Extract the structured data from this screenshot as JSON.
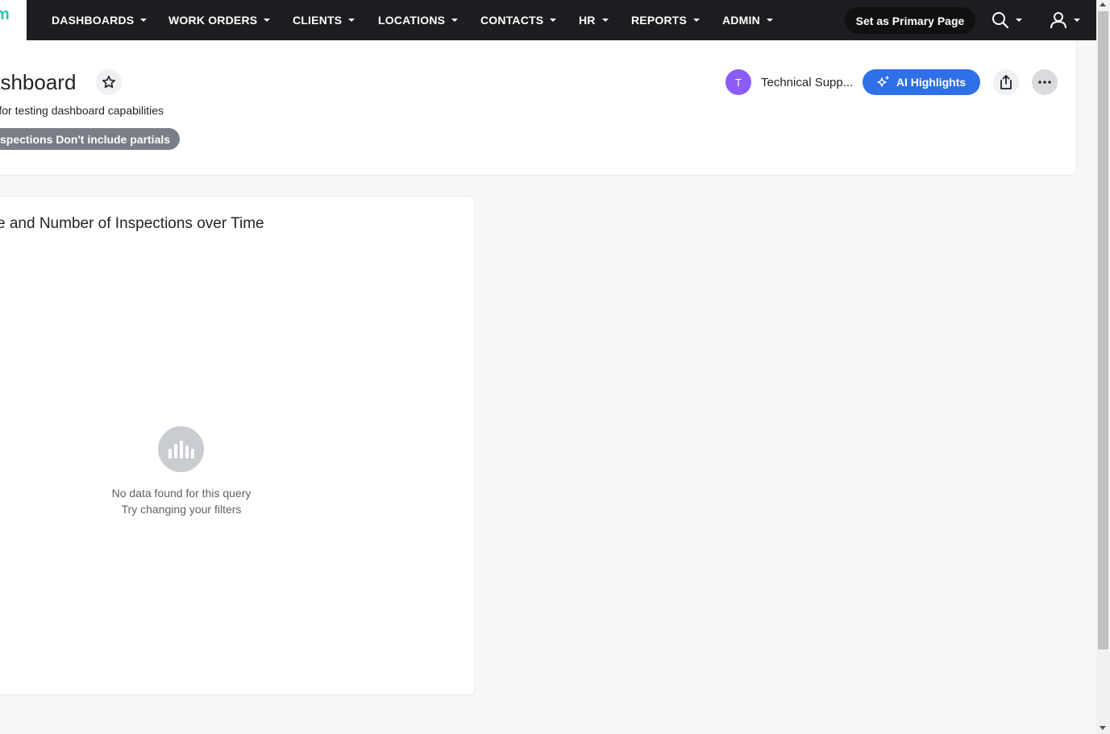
{
  "nav": {
    "items": [
      {
        "label": "DASHBOARDS"
      },
      {
        "label": "WORK ORDERS"
      },
      {
        "label": "CLIENTS"
      },
      {
        "label": "LOCATIONS"
      },
      {
        "label": "CONTACTS"
      },
      {
        "label": "HR"
      },
      {
        "label": "REPORTS"
      },
      {
        "label": "ADMIN"
      }
    ],
    "primary_page_label": "Set as Primary Page",
    "search_icon": "search-icon",
    "user_icon": "user-icon"
  },
  "dashboard": {
    "title": "ashboard",
    "description": "rd for testing dashboard capabilities",
    "filter_chip": "spections Don't include partials",
    "owner_initial": "T",
    "owner_name": "Technical Supp...",
    "ai_button_label": "AI Highlights"
  },
  "widget": {
    "title": "e and Number of Inspections over Time",
    "empty_title": "No data found for this query",
    "empty_hint": "Try changing your filters"
  },
  "colors": {
    "nav_bg": "#1b1d20",
    "accent_blue": "#2f6fe8",
    "avatar_purple": "#8b5cf6",
    "chip_gray": "#7a7e86",
    "logo_teal": "#2ec7b2"
  }
}
